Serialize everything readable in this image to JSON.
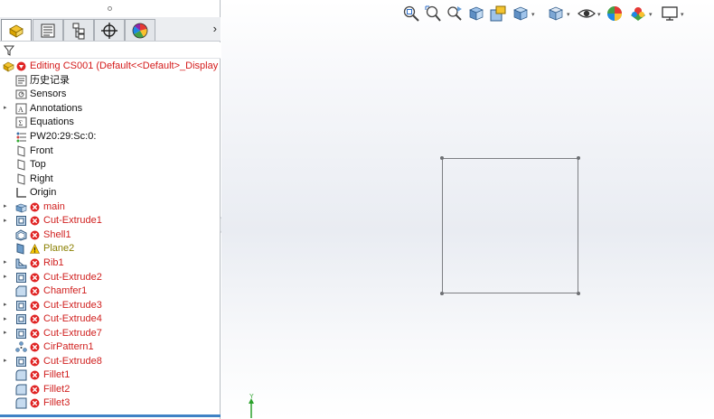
{
  "tabs": [
    {
      "name": "featuremanager"
    },
    {
      "name": "propertymanager"
    },
    {
      "name": "configurationmanager"
    },
    {
      "name": "dimxpertmanager"
    },
    {
      "name": "displaymanager"
    }
  ],
  "tab_more": "›",
  "tree": {
    "root": "Editing CS001  (Default<<Default>_Display S",
    "items": [
      {
        "label": "历史记录",
        "icon": "history-icon",
        "expand": false,
        "status": "none"
      },
      {
        "label": "Sensors",
        "icon": "sensor-icon",
        "expand": false,
        "status": "none"
      },
      {
        "label": "Annotations",
        "icon": "annotation-icon",
        "expand": true,
        "status": "none"
      },
      {
        "label": "Equations",
        "icon": "equation-icon",
        "expand": false,
        "status": "none"
      },
      {
        "label": "PW20:29:Sc:0:",
        "icon": "material-icon",
        "expand": false,
        "status": "none"
      },
      {
        "label": "Front",
        "icon": "plane-icon",
        "expand": false,
        "status": "none"
      },
      {
        "label": "Top",
        "icon": "plane-icon",
        "expand": false,
        "status": "none"
      },
      {
        "label": "Right",
        "icon": "plane-icon",
        "expand": false,
        "status": "none"
      },
      {
        "label": "Origin",
        "icon": "origin-icon",
        "expand": false,
        "status": "none"
      },
      {
        "label": "main",
        "icon": "extrude-icon",
        "expand": true,
        "status": "error"
      },
      {
        "label": "Cut-Extrude1",
        "icon": "cut-extrude-icon",
        "expand": true,
        "status": "error"
      },
      {
        "label": "Shell1",
        "icon": "shell-icon",
        "expand": false,
        "status": "error"
      },
      {
        "label": "Plane2",
        "icon": "plane-feature-icon",
        "expand": false,
        "status": "warning"
      },
      {
        "label": "Rib1",
        "icon": "rib-icon",
        "expand": true,
        "status": "error"
      },
      {
        "label": "Cut-Extrude2",
        "icon": "cut-extrude-icon",
        "expand": true,
        "status": "error"
      },
      {
        "label": "Chamfer1",
        "icon": "chamfer-icon",
        "expand": false,
        "status": "error"
      },
      {
        "label": "Cut-Extrude3",
        "icon": "cut-extrude-icon",
        "expand": true,
        "status": "error"
      },
      {
        "label": "Cut-Extrude4",
        "icon": "cut-extrude-icon",
        "expand": true,
        "status": "error"
      },
      {
        "label": "Cut-Extrude7",
        "icon": "cut-extrude-icon",
        "expand": true,
        "status": "error"
      },
      {
        "label": "CirPattern1",
        "icon": "pattern-icon",
        "expand": false,
        "status": "error"
      },
      {
        "label": "Cut-Extrude8",
        "icon": "cut-extrude-icon",
        "expand": true,
        "status": "error"
      },
      {
        "label": "Fillet1",
        "icon": "fillet-icon",
        "expand": false,
        "status": "error"
      },
      {
        "label": "Fillet2",
        "icon": "fillet-icon",
        "expand": false,
        "status": "error"
      },
      {
        "label": "Fillet3",
        "icon": "fillet-icon",
        "expand": false,
        "status": "error"
      }
    ]
  },
  "heads_up_toolbar": [
    {
      "name": "zoom-to-fit-icon",
      "dropdown": false
    },
    {
      "name": "zoom-to-area-icon",
      "dropdown": false
    },
    {
      "name": "previous-view-icon",
      "dropdown": false
    },
    {
      "name": "section-view-icon",
      "dropdown": false
    },
    {
      "name": "dynamic-annotation-icon",
      "dropdown": false
    },
    {
      "name": "view-orientation-icon",
      "dropdown": true
    },
    {
      "name": "display-style-icon",
      "dropdown": true
    },
    {
      "name": "hide-show-items-icon",
      "dropdown": true
    },
    {
      "name": "edit-appearance-icon",
      "dropdown": false
    },
    {
      "name": "apply-scene-icon",
      "dropdown": true
    },
    {
      "name": "view-settings-icon",
      "dropdown": true
    }
  ],
  "triad_label": "Y",
  "colors": {
    "error": "#d0201f",
    "warning": "#8a7f00",
    "accent": "#3f82c5",
    "sketch": "#7d7f83"
  }
}
